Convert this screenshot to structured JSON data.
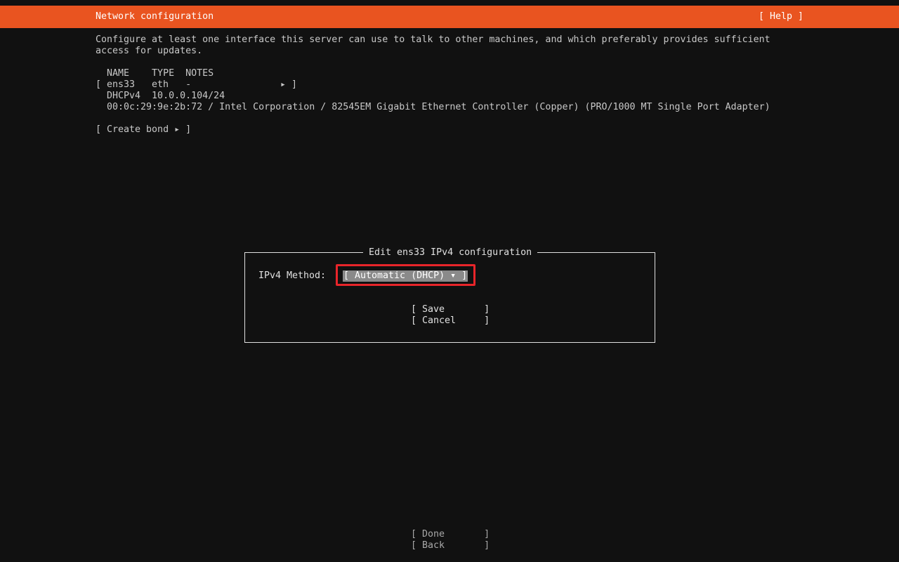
{
  "header": {
    "title": "Network configuration",
    "help_label": "[ Help ]"
  },
  "description": {
    "line1": "Configure at least one interface this server can use to talk to other machines, and which preferably provides sufficient",
    "line2": "access for updates."
  },
  "table": {
    "header": "  NAME    TYPE  NOTES",
    "row_open": "[",
    "row_main": "ens33   eth   -",
    "row_arrow": "▸ ]",
    "dhcp": "  DHCPv4  10.0.0.104/24",
    "hw": "  00:0c:29:9e:2b:72 / Intel Corporation / 82545EM Gigabit Ethernet Controller (Copper) (PRO/1000 MT Single Port Adapter)"
  },
  "create_bond_label": "[ Create bond ▸ ]",
  "dialog": {
    "title": "Edit ens33 IPv4 configuration",
    "method_label": "IPv4 Method:",
    "method_value": "[ Automatic (DHCP) ▾ ]",
    "save_label": "[ Save       ]",
    "cancel_label": "[ Cancel     ]"
  },
  "footer": {
    "done_label": "[ Done       ]",
    "back_label": "[ Back       ]"
  },
  "colors": {
    "header_bg": "#e95420",
    "background": "#111111",
    "highlight": "#e8252a"
  }
}
